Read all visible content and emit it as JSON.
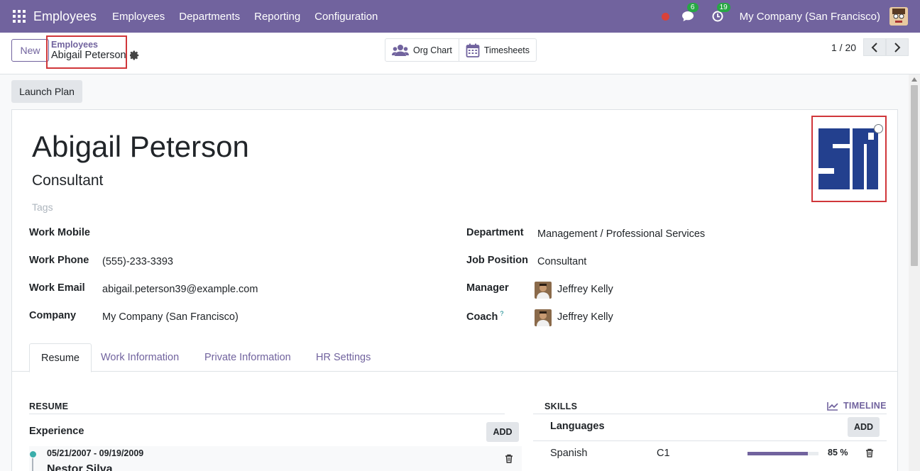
{
  "navbar": {
    "brand": "Employees",
    "menu": [
      "Employees",
      "Departments",
      "Reporting",
      "Configuration"
    ],
    "messages_count": "6",
    "activities_count": "19",
    "company": "My Company (San Francisco)"
  },
  "control": {
    "new_label": "New",
    "breadcrumb_parent": "Employees",
    "breadcrumb_current": "Abigail Peterson",
    "org_chart_label": "Org Chart",
    "timesheets_label": "Timesheets",
    "pager": "1 / 20"
  },
  "statusbar": {
    "launch_plan_label": "Launch Plan"
  },
  "employee": {
    "name": "Abigail Peterson",
    "job_title": "Consultant",
    "tags_placeholder": "Tags"
  },
  "fields_left": [
    {
      "label": "Work Mobile",
      "value": ""
    },
    {
      "label": "Work Phone",
      "value": "(555)-233-3393"
    },
    {
      "label": "Work Email",
      "value": "abigail.peterson39@example.com"
    },
    {
      "label": "Company",
      "value": "My Company (San Francisco)"
    }
  ],
  "fields_right": [
    {
      "label": "Department",
      "value": "Management / Professional Services"
    },
    {
      "label": "Job Position",
      "value": "Consultant"
    },
    {
      "label": "Manager",
      "value": "Jeffrey Kelly"
    },
    {
      "label": "Coach",
      "value": "Jeffrey Kelly",
      "help": "?"
    }
  ],
  "tabs": [
    "Resume",
    "Work Information",
    "Private Information",
    "HR Settings"
  ],
  "resume": {
    "title": "RESUME",
    "group": "Experience",
    "add_label": "ADD",
    "entry_dates": "05/21/2007 - 09/19/2009",
    "entry_name": "Nestor Silva"
  },
  "skills": {
    "title": "SKILLS",
    "timeline_label": "TIMELINE",
    "group": "Languages",
    "add_label": "ADD",
    "skill_name": "Spanish",
    "skill_level": "C1",
    "skill_progress_label": "85 %",
    "skill_progress": 0.85
  },
  "colors": {
    "brand": "#71639e",
    "highlight": "#d0363a",
    "badge": "#28a745"
  }
}
